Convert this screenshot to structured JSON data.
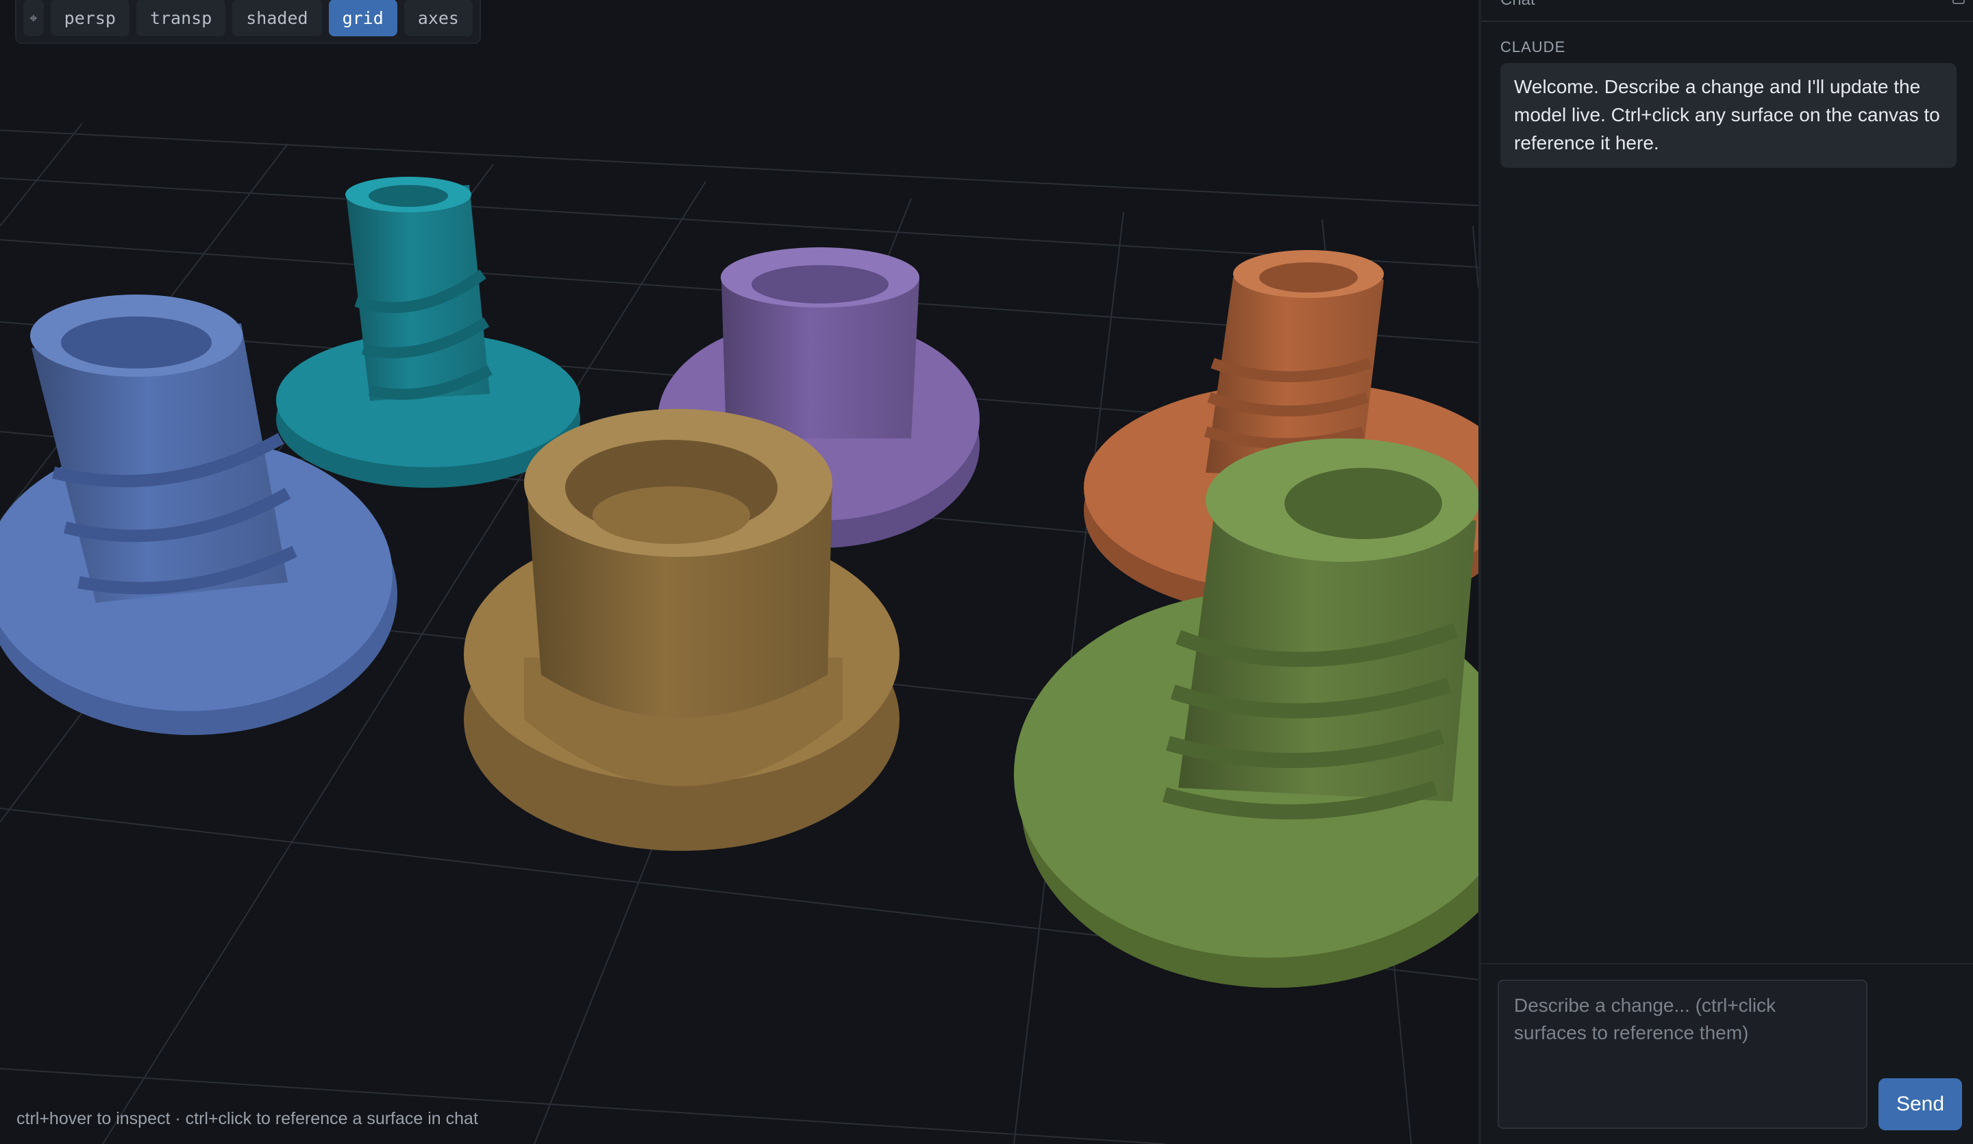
{
  "toolbar": {
    "settings_icon": "crosshair-icon",
    "buttons": [
      "persp",
      "transp",
      "shaded",
      "grid",
      "axes"
    ],
    "active": "grid"
  },
  "viewport": {
    "hint": "ctrl+hover to inspect · ctrl+click to reference a surface in chat",
    "model_colors": {
      "blue": "#5b79b9",
      "teal": "#1c8a98",
      "purple": "#7f67aa",
      "gold": "#9a7a45",
      "orange": "#b8693f",
      "green": "#6b8a45"
    }
  },
  "chat": {
    "title": "Chat",
    "messages": [
      {
        "author": "CLAUDE",
        "text": "Welcome. Describe a change and I'll update the model live. Ctrl+click any surface on the canvas to reference it here."
      }
    ],
    "composer": {
      "placeholder": "Describe a change... (ctrl+click surfaces to reference them)",
      "value": ""
    },
    "send_label": "Send",
    "accent": "#3b6db0"
  }
}
